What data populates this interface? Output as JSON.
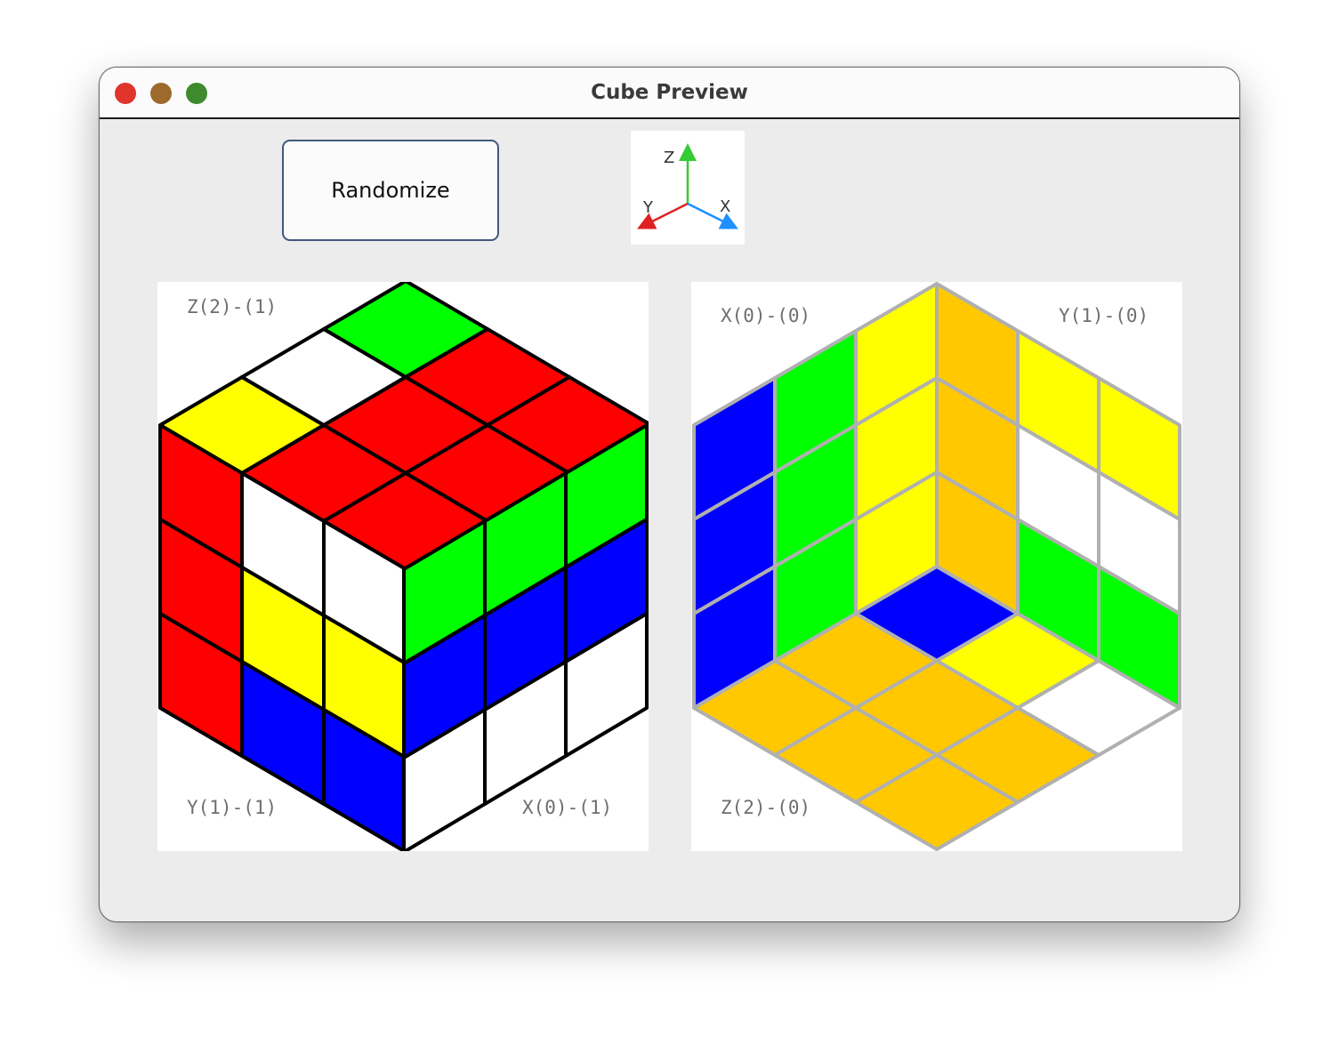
{
  "window": {
    "title": "Cube Preview",
    "controls": [
      "close",
      "minimize",
      "maximize"
    ]
  },
  "toolbar": {
    "randomize_label": "Randomize"
  },
  "axes_legend": {
    "z_label": "Z",
    "y_label": "Y",
    "x_label": "X",
    "colors": {
      "z": "#33cc33",
      "y": "#e02020",
      "x": "#1e90ff"
    }
  },
  "palette": {
    "R": "#ff0000",
    "G": "#00ff00",
    "B": "#0000ff",
    "W": "#ffffff",
    "Y": "#ffff00",
    "O": "#ffc800"
  },
  "front_view": {
    "labels": {
      "top_left": "Z(2)-(1)",
      "bottom_left": "Y(1)-(1)",
      "bottom_right": "X(0)-(1)"
    },
    "top_face": [
      [
        "Y",
        "W",
        "G"
      ],
      [
        "R",
        "R",
        "R"
      ],
      [
        "R",
        "R",
        "R"
      ]
    ],
    "left_face": [
      [
        "R",
        "W",
        "W"
      ],
      [
        "R",
        "Y",
        "Y"
      ],
      [
        "R",
        "B",
        "B"
      ]
    ],
    "right_face": [
      [
        "G",
        "G",
        "G"
      ],
      [
        "B",
        "B",
        "B"
      ],
      [
        "W",
        "W",
        "W"
      ]
    ]
  },
  "back_view": {
    "labels": {
      "top_left": "X(0)-(0)",
      "top_right": "Y(1)-(0)",
      "bottom_left": "Z(2)-(0)"
    },
    "left_face": [
      [
        "B",
        "G",
        "Y"
      ],
      [
        "B",
        "G",
        "Y"
      ],
      [
        "B",
        "G",
        "Y"
      ]
    ],
    "right_face": [
      [
        "O",
        "Y",
        "Y"
      ],
      [
        "O",
        "W",
        "W"
      ],
      [
        "O",
        "G",
        "G"
      ]
    ],
    "bottom_face": [
      [
        "B",
        "O",
        "O"
      ],
      [
        "Y",
        "O",
        "O"
      ],
      [
        "W",
        "O",
        "O"
      ]
    ]
  }
}
